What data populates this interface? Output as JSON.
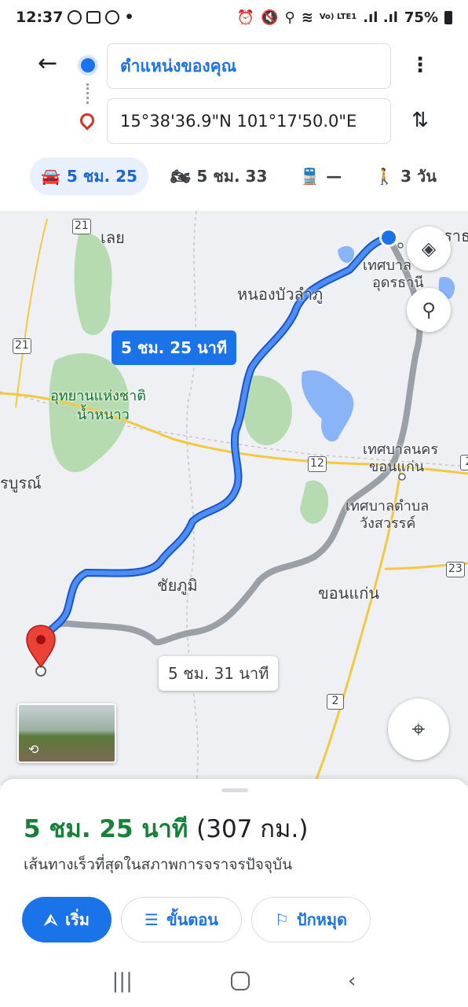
{
  "status_bar": {
    "time": "12:37",
    "left_icons": [
      "cast-icon",
      "gallery-icon",
      "cast-icon",
      "dot"
    ],
    "network": "Vo) LTE1",
    "battery": "75%"
  },
  "directions": {
    "origin": "ตำแหน่งของคุณ",
    "destination": "15°38'36.9\"N 101°17'50.0\"E"
  },
  "modes": [
    {
      "name": "car",
      "icon": "car-icon",
      "label": "5 ชม. 25",
      "active": true
    },
    {
      "name": "motorcycle",
      "icon": "motorcycle-icon",
      "label": "5 ชม. 33",
      "active": false
    },
    {
      "name": "transit",
      "icon": "train-icon",
      "label": "—",
      "active": false
    },
    {
      "name": "walk",
      "icon": "walk-icon",
      "label": "3 วัน",
      "active": false
    }
  ],
  "map": {
    "labels": {
      "loei": "เลย",
      "udon_partial": "อุดราธ",
      "udon_muni": "เทศบาล",
      "udon_name": "อุดรธานี",
      "nongbua": "หนองบัวลำภู",
      "park_line1": "อุทยานแห่งชาติ",
      "park_line2": "น้ำหนาว",
      "khonkaen_city_line1": "เทศบาลนคร",
      "khonkaen_city_line2": "ขอนแก่น",
      "wangsawang_line1": "เทศบาลตำบล",
      "wangsawang_line2": "วังสวรรค์",
      "chaiyaphum": "ชัยภูมิ",
      "khonkaen": "ขอนแก่น",
      "phetchabun_partial": "รบูรณ์"
    },
    "shields": [
      "21",
      "21",
      "12",
      "23",
      "2",
      "2"
    ],
    "primary_route_label": "5 ชม. 25 นาที",
    "alt_route_label": "5 ชม. 31 นาที",
    "colors": {
      "route_primary": "#1a73e8",
      "route_alt": "#9aa0a6",
      "destination_pin": "#ea4335"
    }
  },
  "sheet": {
    "duration": "5 ชม. 25 นาที",
    "distance": "(307 กม.)",
    "subtitle": "เส้นทางเร็วที่สุดในสภาพการจราจรปัจจุบัน",
    "buttons": {
      "start": "เริ่ม",
      "steps": "ขั้นตอน",
      "pin": "ปักหมุด"
    }
  },
  "navbar": {
    "recents": "|||",
    "back": "‹"
  }
}
